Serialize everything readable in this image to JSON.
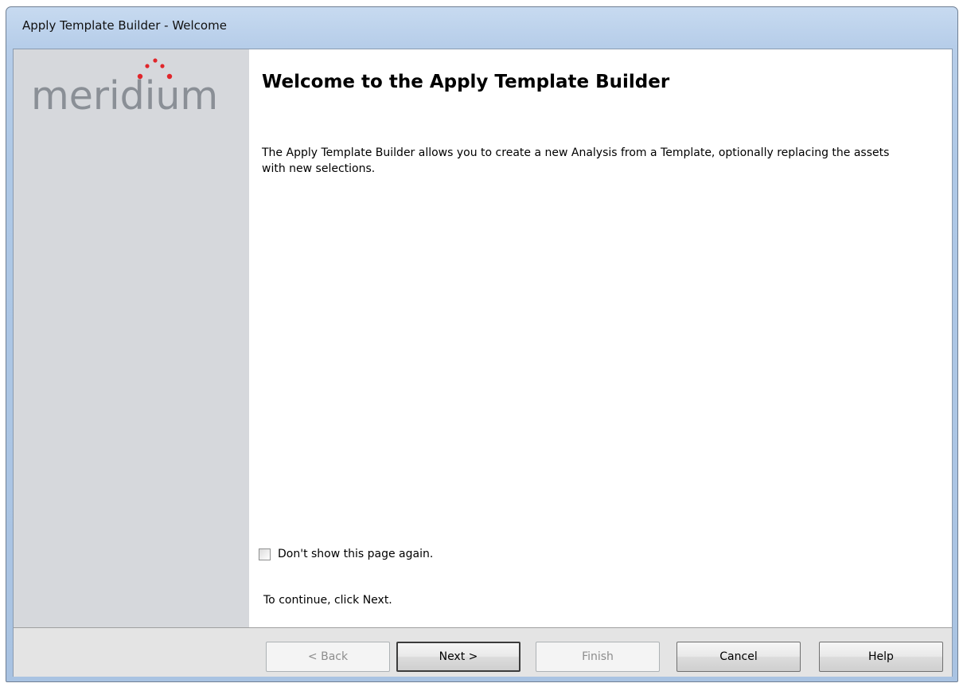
{
  "window": {
    "title": "Apply Template Builder - Welcome"
  },
  "sidebar": {
    "logo_text": "meridium",
    "logo_color": "#8a8f96",
    "logo_dot_color": "#e0262b"
  },
  "page": {
    "heading": "Welcome to the Apply Template Builder",
    "description": "The Apply Template Builder allows you to create a new Analysis from a Template, optionally replacing the assets with new selections.",
    "dont_show_label": "Don't show this page again.",
    "dont_show_checked": false,
    "continue_hint": "To continue, click Next."
  },
  "buttons": {
    "back": "< Back",
    "next": "Next >",
    "finish": "Finish",
    "cancel": "Cancel",
    "help": "Help"
  }
}
